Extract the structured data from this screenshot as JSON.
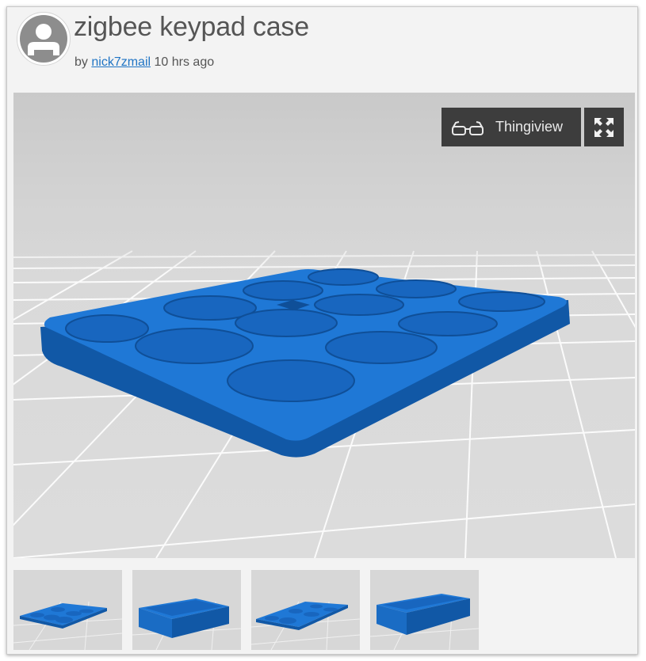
{
  "header": {
    "title": "zigbee keypad case",
    "by_prefix": "by",
    "author": "nick7zmail",
    "time_ago": "10 hrs ago"
  },
  "viewer": {
    "thingiview_label": "Thingiview"
  },
  "thumbnails": [
    {
      "label": "keypad plate view 1"
    },
    {
      "label": "case box view 1"
    },
    {
      "label": "keypad plate view 2"
    },
    {
      "label": "case box view 2"
    }
  ],
  "colors": {
    "model": "#1f78d6",
    "model_dark": "#1158a6",
    "accent_link": "#1f74c4",
    "button_bg": "#3d3d3d"
  }
}
